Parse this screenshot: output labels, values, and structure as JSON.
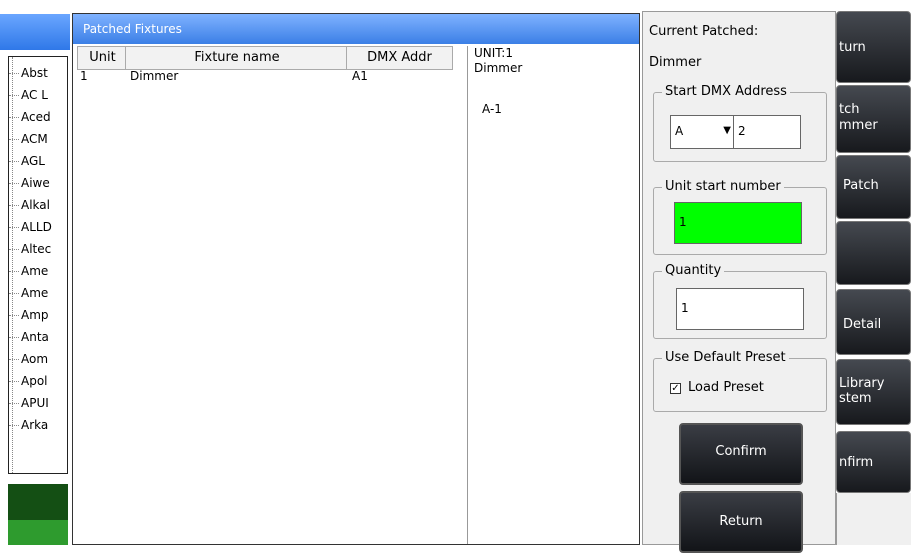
{
  "tree": {
    "items": [
      "Abst",
      "AC L",
      "Aced",
      "ACM",
      "AGL",
      "Aiwe",
      "Alkal",
      "ALLD",
      "Altec",
      "Ame",
      "Ame",
      "Amp",
      "Anta",
      "Aom",
      "Apol",
      "APUI",
      "Arka"
    ]
  },
  "fixtures_window": {
    "title": "Patched Fixtures",
    "columns": [
      "Unit",
      "Fixture name",
      "DMX Addr"
    ],
    "rows": [
      {
        "unit": "1",
        "name": "Dimmer",
        "addr": "A1"
      }
    ],
    "info": {
      "unit": "UNIT:1",
      "name": "Dimmer",
      "address": "A-1"
    }
  },
  "panel": {
    "current_label": "Current Patched:",
    "current_value": "Dimmer",
    "start_dmx": {
      "title": "Start DMX Address",
      "universe": "A",
      "address": "2"
    },
    "unit_start": {
      "title": "Unit start number",
      "value": "1"
    },
    "quantity": {
      "title": "Quantity",
      "value": "1"
    },
    "default_preset": {
      "title": "Use Default Preset",
      "checkbox_label": "Load Preset",
      "checked": true
    },
    "confirm_label": "Confirm",
    "return_label": "Return"
  },
  "side_buttons": {
    "b1": "turn",
    "b2a": "tch",
    "b2b": "mmer",
    "b3": "Patch",
    "b4": "",
    "b5": "Detail",
    "b6a": "Library",
    "b6b": "stem",
    "b7": "nfirm"
  },
  "colors": {
    "title_blue": "#3b7fe6",
    "unit_start_green": "#00ff00",
    "dark_green": "#144f14",
    "green": "#2e9b2e"
  }
}
